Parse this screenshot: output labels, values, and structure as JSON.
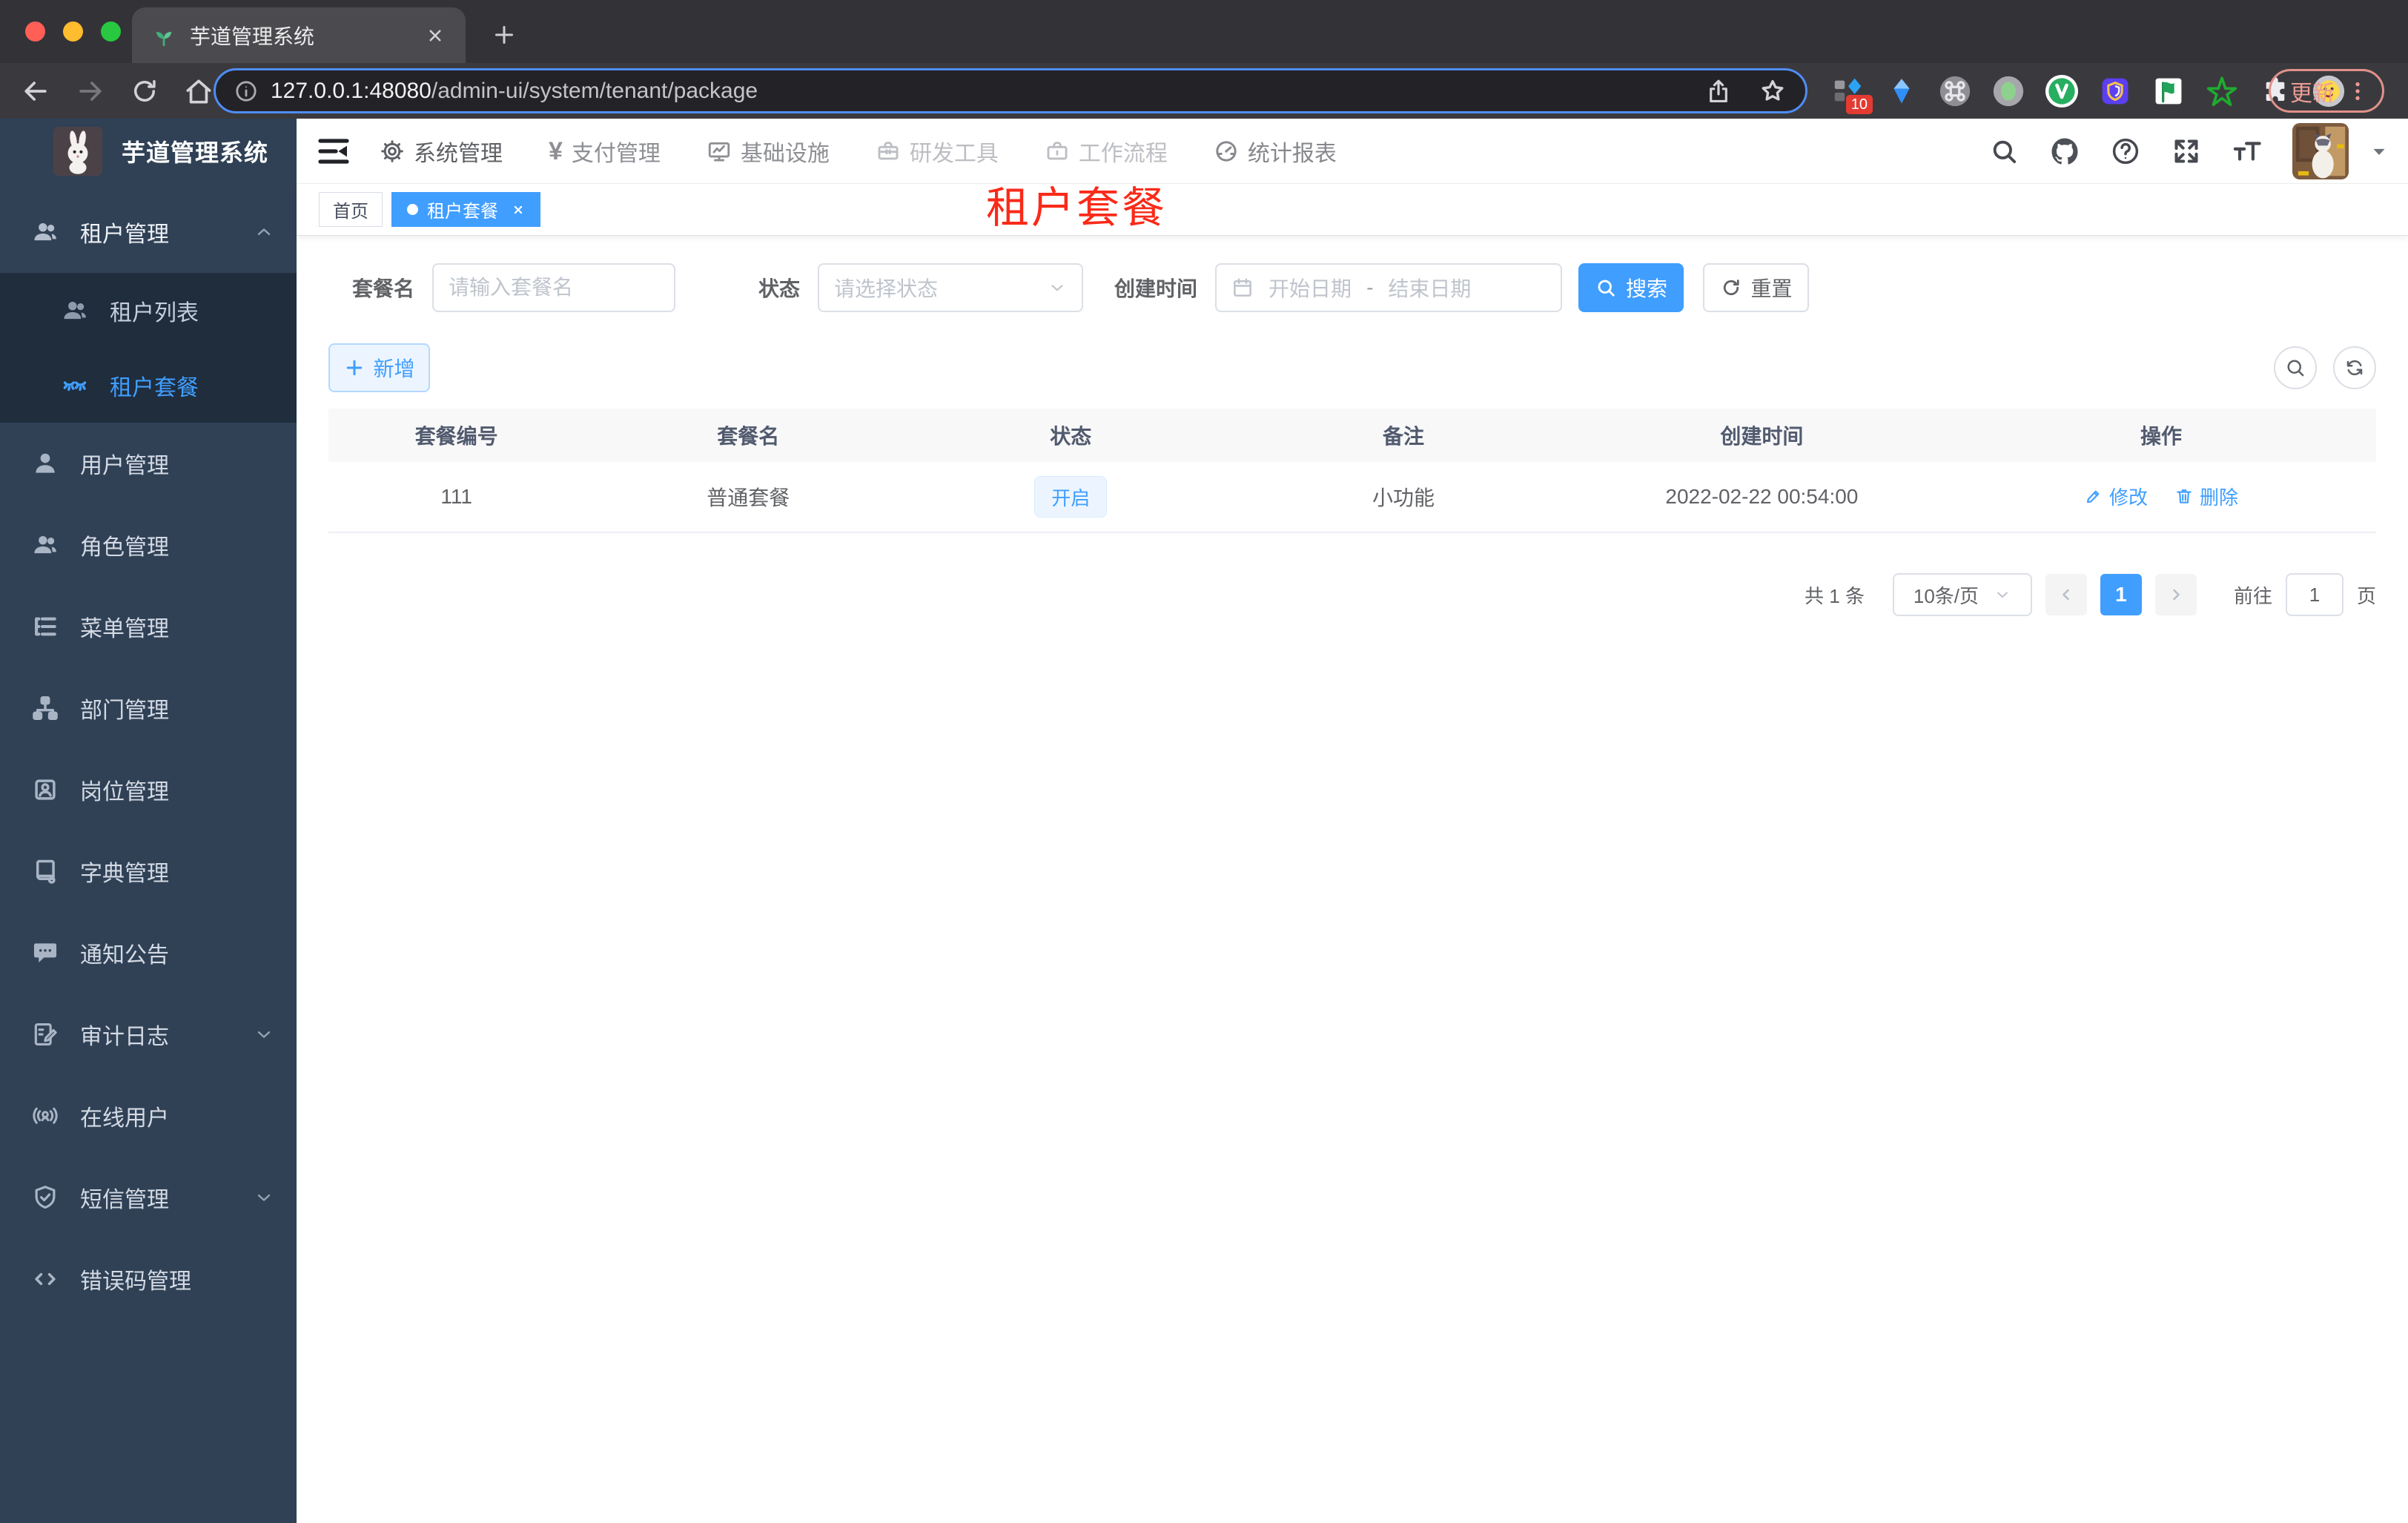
{
  "browser": {
    "tab_title": "芋道管理系统",
    "url_host": "127.0.0.1:48080",
    "url_path": "/admin-ui/system/tenant/package",
    "extension_badge": "10",
    "update_label": "更新"
  },
  "icons": {
    "yen": "¥"
  },
  "sidebar": {
    "logo_title": "芋道管理系统",
    "items": [
      "租户管理",
      "租户列表",
      "租户套餐",
      "用户管理",
      "角色管理",
      "菜单管理",
      "部门管理",
      "岗位管理",
      "字典管理",
      "通知公告",
      "审计日志",
      "在线用户",
      "短信管理",
      "错误码管理"
    ]
  },
  "topnav": {
    "items": [
      "系统管理",
      "支付管理",
      "基础设施",
      "研发工具",
      "工作流程",
      "统计报表"
    ]
  },
  "tags": {
    "home": "首页",
    "active": "租户套餐"
  },
  "watermark": "租户套餐",
  "filters": {
    "name_label": "套餐名",
    "name_placeholder": "请输入套餐名",
    "status_label": "状态",
    "status_placeholder": "请选择状态",
    "date_label": "创建时间",
    "date_start_placeholder": "开始日期",
    "date_separator": "-",
    "date_end_placeholder": "结束日期",
    "search_label": "搜索",
    "reset_label": "重置"
  },
  "toolbar": {
    "add_label": "新增"
  },
  "table": {
    "headers": [
      "套餐编号",
      "套餐名",
      "状态",
      "备注",
      "创建时间",
      "操作"
    ],
    "rows": [
      {
        "id": "111",
        "name": "普通套餐",
        "status": "开启",
        "remark": "小功能",
        "created_at": "2022-02-22 00:54:00",
        "edit_label": "修改",
        "delete_label": "删除"
      }
    ]
  },
  "pagination": {
    "total_text": "共 1 条",
    "page_size_text": "10条/页",
    "current_page": "1",
    "goto_label": "前往",
    "goto_value": "1",
    "page_unit": "页"
  },
  "colors": {
    "accent": "#409eff",
    "sidebar_bg": "#304156",
    "submenu_bg": "#1f2d3d",
    "watermark_red": "#fa2a19",
    "status_tag_bg": "#ecf5ff",
    "tag_active_bg": "#409eff"
  }
}
